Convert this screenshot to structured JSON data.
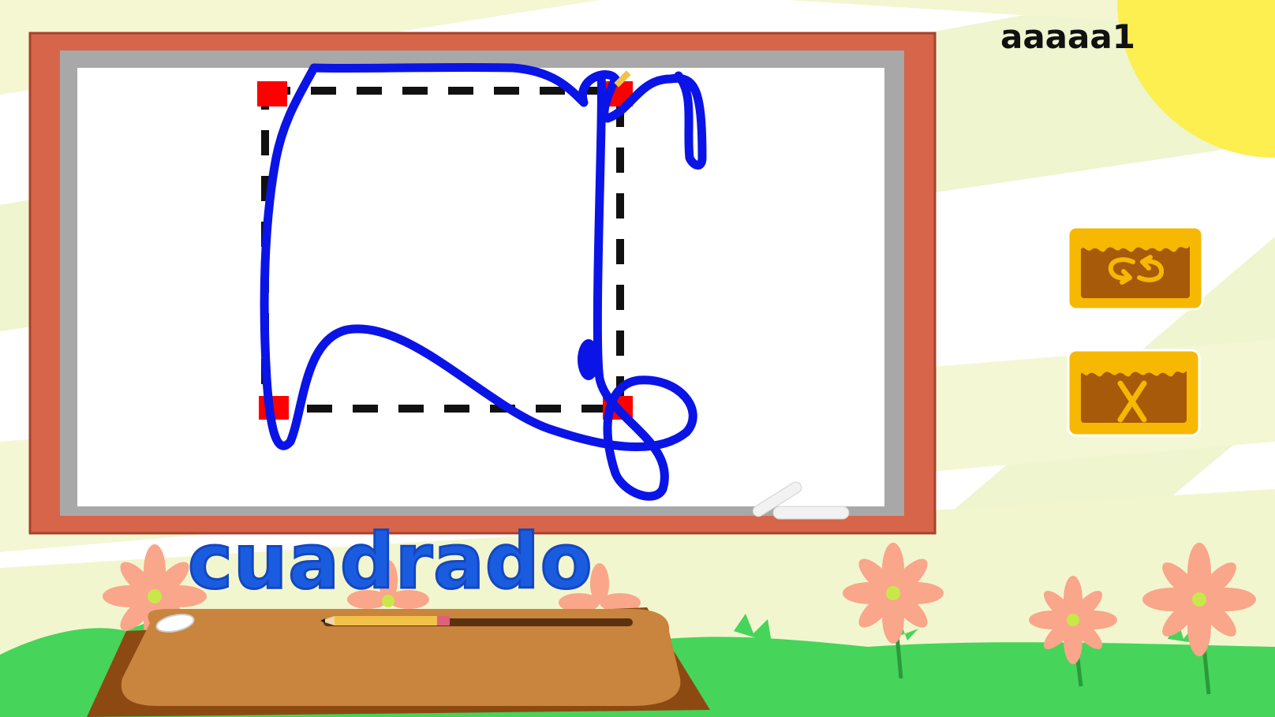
{
  "header": {
    "username": "aaaaa1"
  },
  "board": {
    "word": "cuadrado"
  },
  "buttons": {
    "reset": {
      "icon": "swap-arrows-icon"
    },
    "close": {
      "icon": "x-icon"
    }
  },
  "colors": {
    "stroke": "#0a14e6",
    "frame": "#d6654a",
    "button": "#f6b800",
    "panel": "#a65a0a",
    "dot": "#ff0000"
  }
}
